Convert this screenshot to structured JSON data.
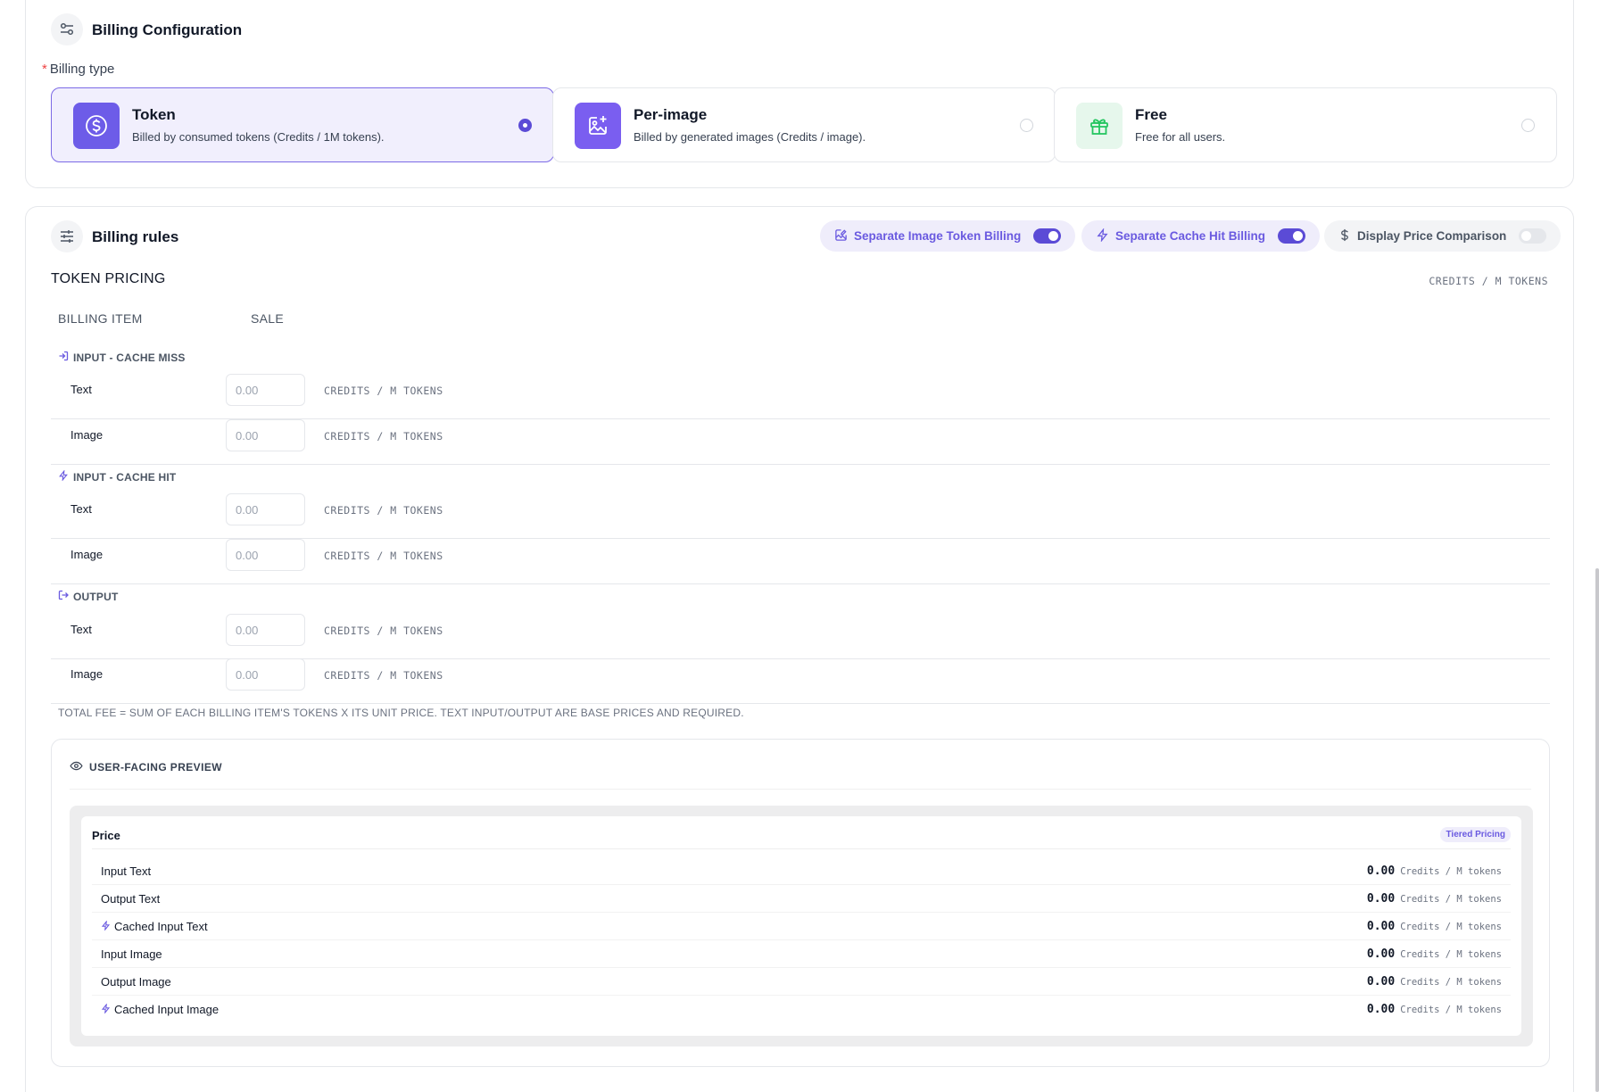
{
  "config": {
    "title": "Billing Configuration",
    "billing_type_label": "Billing type",
    "required_mark": "*",
    "options": [
      {
        "title": "Token",
        "desc": "Billed by consumed tokens (Credits / 1M tokens).",
        "icon": "dollar-circle-icon",
        "selected": true
      },
      {
        "title": "Per-image",
        "desc": "Billed by generated images (Credits / image).",
        "icon": "image-plus-icon",
        "selected": false
      },
      {
        "title": "Free",
        "desc": "Free for all users.",
        "icon": "gift-icon",
        "selected": false
      }
    ]
  },
  "rules": {
    "title": "Billing rules",
    "toggles": [
      {
        "label": "Separate Image Token Billing",
        "on": true,
        "icon": "image-edit-icon"
      },
      {
        "label": "Separate Cache Hit Billing",
        "on": true,
        "icon": "lightning-icon"
      },
      {
        "label": "Display Price Comparison",
        "on": false,
        "icon": "dollar-icon"
      }
    ],
    "section_title": "TOKEN PRICING",
    "unit_right": "CREDITS / M TOKENS",
    "col_billing_item": "BILLING ITEM",
    "col_sale": "SALE",
    "groups": [
      {
        "title": "INPUT - CACHE MISS",
        "icon": "login-arrow-icon",
        "rows": [
          {
            "label": "Text",
            "placeholder": "0.00",
            "unit": "CREDITS / M TOKENS"
          },
          {
            "label": "Image",
            "placeholder": "0.00",
            "unit": "CREDITS / M TOKENS"
          }
        ]
      },
      {
        "title": "INPUT - CACHE HIT",
        "icon": "lightning-icon",
        "rows": [
          {
            "label": "Text",
            "placeholder": "0.00",
            "unit": "CREDITS / M TOKENS"
          },
          {
            "label": "Image",
            "placeholder": "0.00",
            "unit": "CREDITS / M TOKENS"
          }
        ]
      },
      {
        "title": "OUTPUT",
        "icon": "logout-arrow-icon",
        "rows": [
          {
            "label": "Text",
            "placeholder": "0.00",
            "unit": "CREDITS / M TOKENS"
          },
          {
            "label": "Image",
            "placeholder": "0.00",
            "unit": "CREDITS / M TOKENS"
          }
        ]
      }
    ],
    "note": "TOTAL FEE = SUM OF EACH BILLING ITEM'S TOKENS X ITS UNIT PRICE. TEXT INPUT/OUTPUT ARE BASE PRICES AND REQUIRED."
  },
  "preview": {
    "title": "USER-FACING PREVIEW",
    "price_heading": "Price",
    "badge": "Tiered Pricing",
    "rows": [
      {
        "label": "Input Text",
        "value": "0.00",
        "unit": "Credits / M tokens",
        "cached": false
      },
      {
        "label": "Output Text",
        "value": "0.00",
        "unit": "Credits / M tokens",
        "cached": false
      },
      {
        "label": "Cached Input Text",
        "value": "0.00",
        "unit": "Credits / M tokens",
        "cached": true
      },
      {
        "label": "Input Image",
        "value": "0.00",
        "unit": "Credits / M tokens",
        "cached": false
      },
      {
        "label": "Output Image",
        "value": "0.00",
        "unit": "Credits / M tokens",
        "cached": false
      },
      {
        "label": "Cached Input Image",
        "value": "0.00",
        "unit": "Credits / M tokens",
        "cached": true
      }
    ]
  },
  "colors": {
    "accent": "#5b4bd6",
    "accent_soft": "#efedfb",
    "required": "#ef4444",
    "free_green": "#22c55e"
  }
}
